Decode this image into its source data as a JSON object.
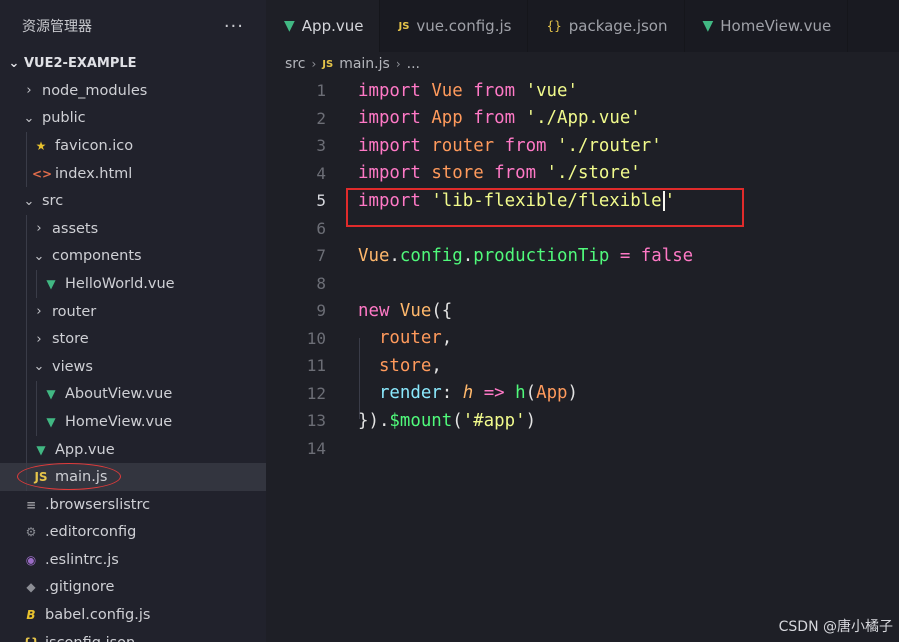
{
  "sidebar": {
    "title": "资源管理器",
    "more_label": "···",
    "project": "VUE2-EXAMPLE",
    "items": [
      {
        "label": "node_modules",
        "indent": 1,
        "chevron": "›",
        "icon": ""
      },
      {
        "label": "public",
        "indent": 1,
        "chevron": "⌄",
        "icon": ""
      },
      {
        "label": "favicon.ico",
        "indent": 2,
        "chevron": "",
        "icon": "star"
      },
      {
        "label": "index.html",
        "indent": 2,
        "chevron": "",
        "icon": "html"
      },
      {
        "label": "src",
        "indent": 1,
        "chevron": "⌄",
        "icon": ""
      },
      {
        "label": "assets",
        "indent": 2,
        "chevron": "›",
        "icon": ""
      },
      {
        "label": "components",
        "indent": 2,
        "chevron": "⌄",
        "icon": ""
      },
      {
        "label": "HelloWorld.vue",
        "indent": 3,
        "chevron": "",
        "icon": "vue"
      },
      {
        "label": "router",
        "indent": 2,
        "chevron": "›",
        "icon": ""
      },
      {
        "label": "store",
        "indent": 2,
        "chevron": "›",
        "icon": ""
      },
      {
        "label": "views",
        "indent": 2,
        "chevron": "⌄",
        "icon": ""
      },
      {
        "label": "AboutView.vue",
        "indent": 3,
        "chevron": "",
        "icon": "vue"
      },
      {
        "label": "HomeView.vue",
        "indent": 3,
        "chevron": "",
        "icon": "vue"
      },
      {
        "label": "App.vue",
        "indent": 2,
        "chevron": "",
        "icon": "vue"
      },
      {
        "label": "main.js",
        "indent": 2,
        "chevron": "",
        "icon": "js",
        "active": true
      },
      {
        "label": ".browserslistrc",
        "indent": 1,
        "chevron": "",
        "icon": "dot"
      },
      {
        "label": ".editorconfig",
        "indent": 1,
        "chevron": "",
        "icon": "gear"
      },
      {
        "label": ".eslintrc.js",
        "indent": 1,
        "chevron": "",
        "icon": "eslint"
      },
      {
        "label": ".gitignore",
        "indent": 1,
        "chevron": "",
        "icon": "git"
      },
      {
        "label": "babel.config.js",
        "indent": 1,
        "chevron": "",
        "icon": "babel"
      },
      {
        "label": "jsconfig.json",
        "indent": 1,
        "chevron": "",
        "icon": "json"
      }
    ]
  },
  "tabs": [
    {
      "label": "App.vue",
      "icon": "vue",
      "active": true
    },
    {
      "label": "vue.config.js",
      "icon": "js"
    },
    {
      "label": "package.json",
      "icon": "json"
    },
    {
      "label": "HomeView.vue",
      "icon": "vue"
    }
  ],
  "breadcrumb": [
    "src",
    "main.js",
    "..."
  ],
  "editor": {
    "current_line": 5,
    "lines": [
      {
        "n": "1",
        "tokens": [
          [
            "kw",
            "import"
          ],
          [
            "pn",
            " "
          ],
          [
            "vr",
            "Vue"
          ],
          [
            "pn",
            " "
          ],
          [
            "kw",
            "from"
          ],
          [
            "pn",
            " "
          ],
          [
            "st",
            "'vue'"
          ]
        ]
      },
      {
        "n": "2",
        "tokens": [
          [
            "kw",
            "import"
          ],
          [
            "pn",
            " "
          ],
          [
            "vr",
            "App"
          ],
          [
            "pn",
            " "
          ],
          [
            "kw",
            "from"
          ],
          [
            "pn",
            " "
          ],
          [
            "st",
            "'./App.vue'"
          ]
        ]
      },
      {
        "n": "3",
        "tokens": [
          [
            "kw",
            "import"
          ],
          [
            "pn",
            " "
          ],
          [
            "vr",
            "router"
          ],
          [
            "pn",
            " "
          ],
          [
            "kw",
            "from"
          ],
          [
            "pn",
            " "
          ],
          [
            "st",
            "'./router'"
          ]
        ]
      },
      {
        "n": "4",
        "tokens": [
          [
            "kw",
            "import"
          ],
          [
            "pn",
            " "
          ],
          [
            "vr",
            "store"
          ],
          [
            "pn",
            " "
          ],
          [
            "kw",
            "from"
          ],
          [
            "pn",
            " "
          ],
          [
            "st",
            "'./store'"
          ]
        ]
      },
      {
        "n": "5",
        "tokens": [
          [
            "kw",
            "import"
          ],
          [
            "pn",
            " "
          ],
          [
            "st",
            "'lib-flexible/flexible"
          ],
          [
            "cursor",
            ""
          ],
          [
            "st",
            "'"
          ]
        ]
      },
      {
        "n": "6",
        "tokens": []
      },
      {
        "n": "7",
        "tokens": [
          [
            "sm",
            "Vue"
          ],
          [
            "pn",
            "."
          ],
          [
            "fn",
            "config"
          ],
          [
            "pn",
            "."
          ],
          [
            "fn",
            "productionTip"
          ],
          [
            "pn",
            " "
          ],
          [
            "kw",
            "="
          ],
          [
            "pn",
            " "
          ],
          [
            "kw",
            "false"
          ]
        ]
      },
      {
        "n": "8",
        "tokens": []
      },
      {
        "n": "9",
        "tokens": [
          [
            "kw",
            "new"
          ],
          [
            "pn",
            " "
          ],
          [
            "sm",
            "Vue"
          ],
          [
            "pn",
            "({"
          ]
        ]
      },
      {
        "n": "10",
        "tokens": [
          [
            "pn",
            "  "
          ],
          [
            "vr",
            "router"
          ],
          [
            "pn",
            ","
          ]
        ]
      },
      {
        "n": "11",
        "tokens": [
          [
            "pn",
            "  "
          ],
          [
            "vr",
            "store"
          ],
          [
            "pn",
            ","
          ]
        ]
      },
      {
        "n": "12",
        "tokens": [
          [
            "pn",
            "  "
          ],
          [
            "pr",
            "render"
          ],
          [
            "pn",
            ": "
          ],
          [
            "arg",
            "h"
          ],
          [
            "pn",
            " "
          ],
          [
            "kw",
            "=>"
          ],
          [
            "pn",
            " "
          ],
          [
            "fn",
            "h"
          ],
          [
            "pn",
            "("
          ],
          [
            "vr",
            "App"
          ],
          [
            "pn",
            ")"
          ]
        ]
      },
      {
        "n": "13",
        "tokens": [
          [
            "pn",
            "})."
          ],
          [
            "fn",
            "$mount"
          ],
          [
            "pn",
            "("
          ],
          [
            "st",
            "'#app'"
          ],
          [
            "pn",
            ")"
          ]
        ]
      },
      {
        "n": "14",
        "tokens": []
      }
    ]
  },
  "watermark": "CSDN @唐小橘子",
  "colors": {
    "keyword": "#ff79c6",
    "string": "#f1fa8c",
    "function": "#50fa7b",
    "annotation_red": "#e02b2b"
  }
}
